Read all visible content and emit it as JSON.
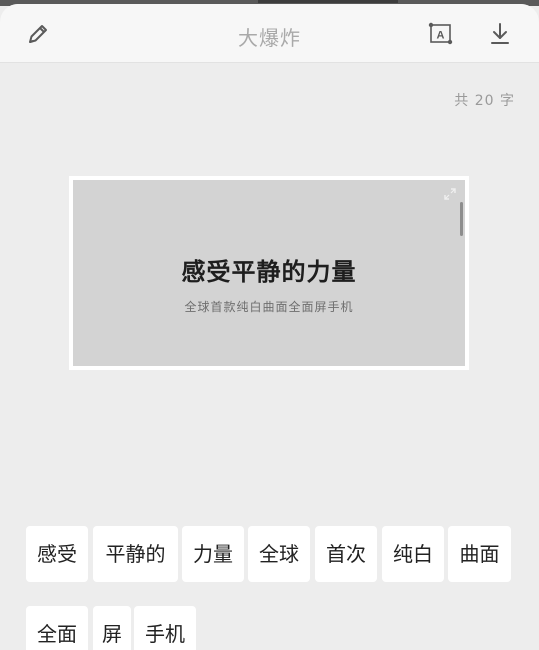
{
  "header": {
    "title": "大爆炸",
    "edit_icon": "pencil-icon",
    "text_icon": "text-select-icon",
    "text_icon_letter": "A",
    "download_icon": "download-icon"
  },
  "char_count": "共 20 字",
  "preview": {
    "title": "感受平静的力量",
    "subtitle": "全球首款纯白曲面全面屏手机"
  },
  "chips": [
    {
      "label": "感受"
    },
    {
      "label": "平静的"
    },
    {
      "label": "力量"
    },
    {
      "label": "全球"
    },
    {
      "label": "首次"
    },
    {
      "label": "纯白"
    },
    {
      "label": "曲面"
    },
    {
      "label": "全面"
    },
    {
      "label": "屏"
    },
    {
      "label": "手机"
    }
  ],
  "colors": {
    "background": "#ededed",
    "header": "#f7f7f7",
    "preview": "#d3d3d3",
    "chip": "#ffffff"
  }
}
